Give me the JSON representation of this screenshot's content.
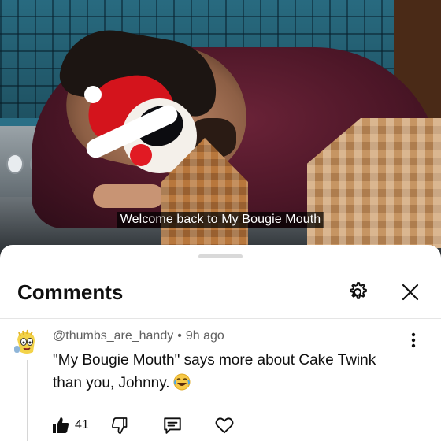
{
  "video": {
    "subtitle": "Welcome back to My Bougie Mouth"
  },
  "comments_panel": {
    "title": "Comments",
    "settings_icon": "gear-icon",
    "close_icon": "close-icon"
  },
  "comment": {
    "author": "@thumbs_are_handy",
    "separator": "•",
    "time_ago": "9h ago",
    "text": "\"My Bougie Mouth\" says more about Cake Twink than you, Johnny.",
    "emoji": "laughing-tears-emoji",
    "likes": "41",
    "icons": {
      "like": "thumbs-up-icon",
      "dislike": "thumbs-down-icon",
      "reply": "reply-icon",
      "heart": "heart-icon",
      "more": "more-vertical-icon"
    }
  },
  "colors": {
    "sheet_bg": "#ffffff",
    "text_primary": "#0f0f0f",
    "text_secondary": "#606060",
    "divider": "#e5e5e5"
  }
}
